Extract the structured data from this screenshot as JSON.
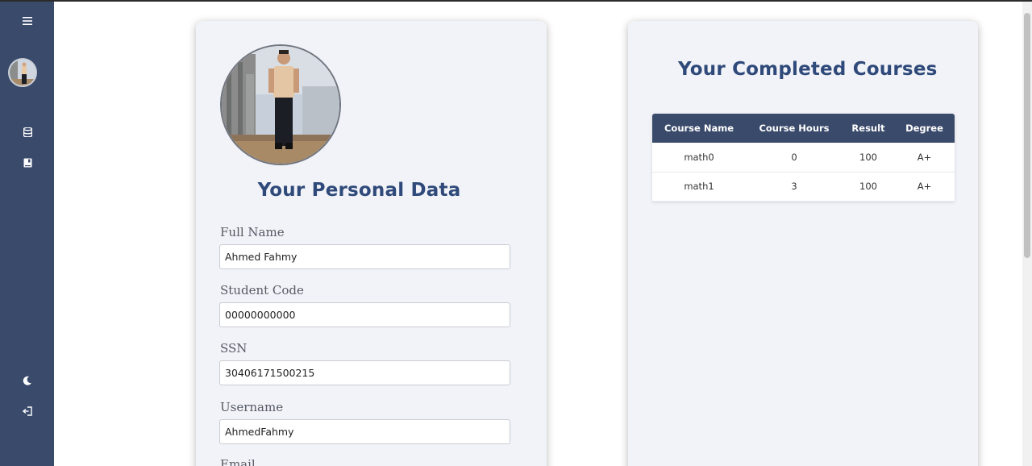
{
  "sidebar": {
    "icons": {
      "menu": "hamburger-menu-icon",
      "database": "database-icon",
      "book": "book-icon",
      "theme": "moon-icon",
      "logout": "logout-icon"
    },
    "accent_color": "#3a4a6b"
  },
  "personal": {
    "title": "Your Personal Data",
    "fields": {
      "full_name": {
        "label": "Full Name",
        "value": "Ahmed Fahmy"
      },
      "student_code": {
        "label": "Student Code",
        "value": "00000000000"
      },
      "ssn": {
        "label": "SSN",
        "value": "30406171500215"
      },
      "username": {
        "label": "Username",
        "value": "AhmedFahmy"
      },
      "email": {
        "label": "Email"
      }
    }
  },
  "courses": {
    "title": "Your Completed Courses",
    "headers": [
      "Course Name",
      "Course Hours",
      "Result",
      "Degree"
    ],
    "rows": [
      [
        "math0",
        "0",
        "100",
        "A+"
      ],
      [
        "math1",
        "3",
        "100",
        "A+"
      ]
    ]
  },
  "colors": {
    "title": "#2f4a7a",
    "card_bg": "#f2f3f8",
    "table_header": "#3a4a6b"
  }
}
